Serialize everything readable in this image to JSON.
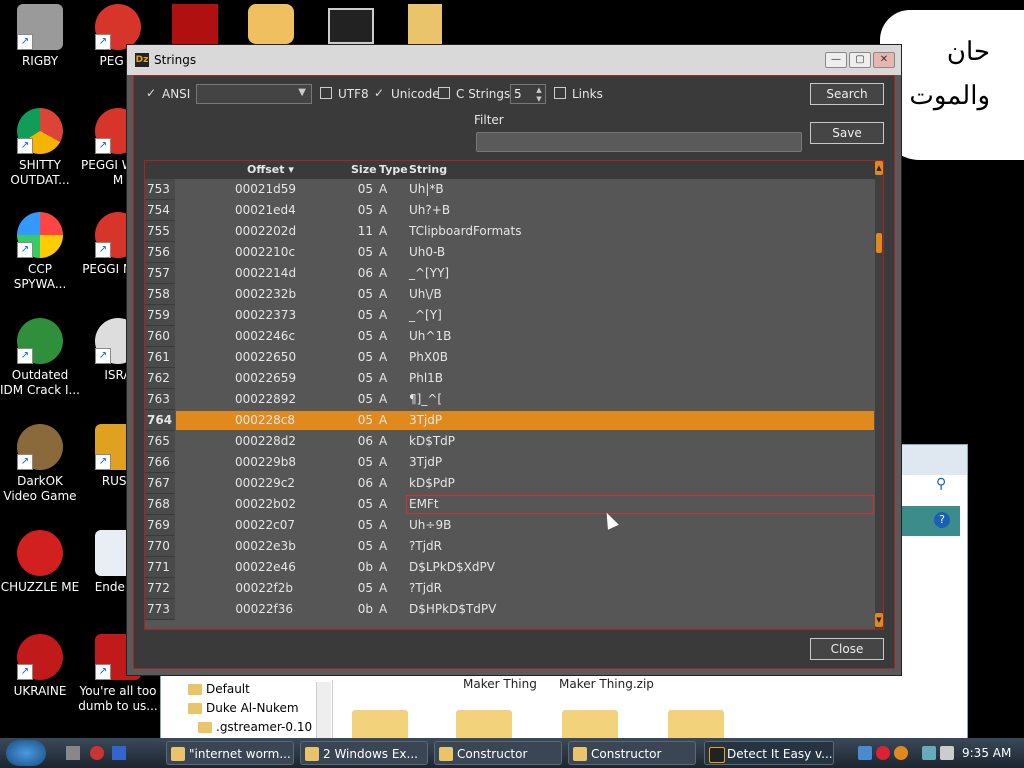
{
  "desktop": {
    "icons": [
      {
        "label": "RIGBY"
      },
      {
        "label": "PEG N"
      },
      {
        "label": "SHITTY OUTDAT..."
      },
      {
        "label": "PEGGI WOW M"
      },
      {
        "label": "CCP SPYWA..."
      },
      {
        "label": "PEGGI NIGH"
      },
      {
        "label": "Outdated IDM Crack I..."
      },
      {
        "label": "ISRA"
      },
      {
        "label": "DarkOK Video Game"
      },
      {
        "label": "RUSS"
      },
      {
        "label": "CHUZZLE ME"
      },
      {
        "label": "Enderm"
      },
      {
        "label": "UKRAINE"
      },
      {
        "label": "You're all too dumb to us..."
      }
    ],
    "speech_text_1": "حان",
    "speech_text_2": "والموت"
  },
  "explorer": {
    "tree": [
      "Default",
      "Duke Al-Nukem",
      ".gstreamer-0.10"
    ],
    "files": [
      "Maker Thing",
      "Maker Thing.zip"
    ]
  },
  "window": {
    "title": "Strings",
    "logo": "Dz",
    "controls": {
      "minimize": "—",
      "maximize": "▢",
      "close": "✕"
    },
    "ansi_label": "ANSI",
    "utf8_label": "UTF8",
    "unicode_label": "Unicode",
    "cstrings_label": "C Strings",
    "spin_value": "5",
    "links_label": "Links",
    "search_button": "Search",
    "save_button": "Save",
    "filter_label": "Filter",
    "filter_value": "",
    "close_button": "Close",
    "columns": {
      "offset": "Offset ▾",
      "size": "Size",
      "type": "Type",
      "string": "String"
    },
    "rows": [
      {
        "idx": "753",
        "offset": "00021d59",
        "size": "05",
        "type": "A",
        "string": "Uh|*B"
      },
      {
        "idx": "754",
        "offset": "00021ed4",
        "size": "05",
        "type": "A",
        "string": "Uh?+B"
      },
      {
        "idx": "755",
        "offset": "0002202d",
        "size": "11",
        "type": "A",
        "string": "TClipboardFormats"
      },
      {
        "idx": "756",
        "offset": "0002210c",
        "size": "05",
        "type": "A",
        "string": "Uh0-B"
      },
      {
        "idx": "757",
        "offset": "0002214d",
        "size": "06",
        "type": "A",
        "string": "_^[YY]"
      },
      {
        "idx": "758",
        "offset": "0002232b",
        "size": "05",
        "type": "A",
        "string": "Uh\\/B"
      },
      {
        "idx": "759",
        "offset": "00022373",
        "size": "05",
        "type": "A",
        "string": "_^[Y]"
      },
      {
        "idx": "760",
        "offset": "0002246c",
        "size": "05",
        "type": "A",
        "string": "Uh^1B"
      },
      {
        "idx": "761",
        "offset": "00022650",
        "size": "05",
        "type": "A",
        "string": "PhX0B"
      },
      {
        "idx": "762",
        "offset": "00022659",
        "size": "05",
        "type": "A",
        "string": "Phl1B"
      },
      {
        "idx": "763",
        "offset": "00022892",
        "size": "05",
        "type": "A",
        "string": "¶]_^["
      },
      {
        "idx": "764",
        "offset": "000228c8",
        "size": "05",
        "type": "A",
        "string": "3TjdP"
      },
      {
        "idx": "765",
        "offset": "000228d2",
        "size": "06",
        "type": "A",
        "string": "kD$TdP"
      },
      {
        "idx": "766",
        "offset": "000229b8",
        "size": "05",
        "type": "A",
        "string": "3TjdP"
      },
      {
        "idx": "767",
        "offset": "000229c2",
        "size": "06",
        "type": "A",
        "string": "kD$PdP"
      },
      {
        "idx": "768",
        "offset": "00022b02",
        "size": "05",
        "type": "A",
        "string": " EMFt"
      },
      {
        "idx": "769",
        "offset": "00022c07",
        "size": "05",
        "type": "A",
        "string": "Uh÷9B"
      },
      {
        "idx": "770",
        "offset": "00022e3b",
        "size": "05",
        "type": "A",
        "string": "?TjdR"
      },
      {
        "idx": "771",
        "offset": "00022e46",
        "size": "0b",
        "type": "A",
        "string": "D$LPkD$XdPV"
      },
      {
        "idx": "772",
        "offset": "00022f2b",
        "size": "05",
        "type": "A",
        "string": "?TjdR"
      },
      {
        "idx": "773",
        "offset": "00022f36",
        "size": "0b",
        "type": "A",
        "string": "D$HPkD$TdPV"
      }
    ]
  },
  "taskbar": {
    "items": [
      "\"internet worm...",
      "2 Windows Ex...",
      "Constructor",
      "Constructor",
      "Detect It Easy v..."
    ],
    "clock": "9:35 AM"
  }
}
